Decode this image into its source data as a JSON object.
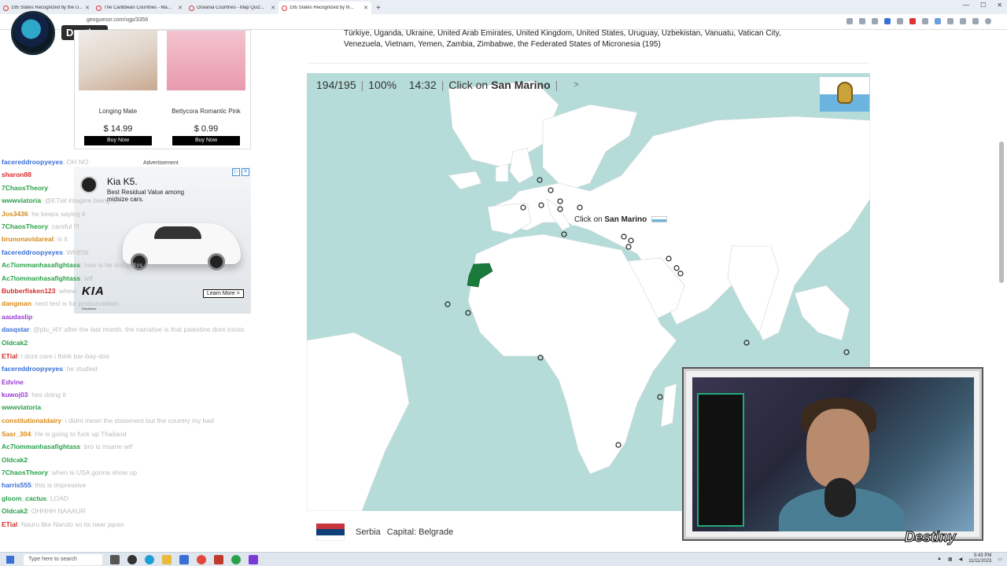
{
  "browser": {
    "tabs": [
      {
        "label": "195 States Recognized by the U...",
        "active": false
      },
      {
        "label": "The Caribbean Countries - Ma...",
        "active": false
      },
      {
        "label": "Oceania Countries - Map Quiz...",
        "active": false
      },
      {
        "label": "195 States Recognized by th...",
        "active": true
      }
    ],
    "url": "geoguessr.com/vgp/3356",
    "new_tab": "+"
  },
  "streamer": {
    "name": "Destiny"
  },
  "products": [
    {
      "name": "Longing Mate",
      "price": "$ 14.99",
      "buy": "Buy Now"
    },
    {
      "name": "Bettycora Romantic Pink",
      "price": "$ 0.99",
      "buy": "Buy Now"
    }
  ],
  "ad": {
    "label": "Advertisement",
    "title": "Kia K5.",
    "text": "Best Residual Value among midsize cars.",
    "brand": "KIA",
    "learn_more": "Learn More >",
    "disclaimer": "Disclaimer"
  },
  "chat": [
    {
      "user": "facereddroopyeyes",
      "color": "#3a6fd6",
      "msg": ": OH NO"
    },
    {
      "user": "sharon88",
      "color": "#d62b2b",
      "msg": ":"
    },
    {
      "user": "7ChaosTheory",
      "color": "#2aa04a",
      "msg": ":"
    },
    {
      "user": "wwwviatoria",
      "color": "#2aa04a",
      "msg": ": @ETial imagine being..."
    },
    {
      "user": "Jos3436",
      "color": "#d68a1a",
      "msg": ": he keeps saying it"
    },
    {
      "user": "7ChaosTheory",
      "color": "#2aa04a",
      "msg": ": careful !!!"
    },
    {
      "user": "brunonavidareal",
      "color": "#d68a1a",
      "msg": ": is it"
    },
    {
      "user": "facereddroopyeyes",
      "color": "#3a6fd6",
      "msg": ": WHEW"
    },
    {
      "user": "Ac7lommanhasafightass",
      "color": "#2aa04a",
      "msg": ": how is he doing this"
    },
    {
      "user": "Ac7lommanhasafightass",
      "color": "#2aa04a",
      "msg": ": wtf"
    },
    {
      "user": "Bubberfisken123",
      "color": "#d62b2b",
      "msg": ": whew"
    },
    {
      "user": "dangman",
      "color": "#d68a1a",
      "msg": ": next test is for pronunciation"
    },
    {
      "user": "aaudaslip",
      "color": "#9a3ad6",
      "msg": ":"
    },
    {
      "user": "dasqstar",
      "color": "#3a6fd6",
      "msg": ": @plu_l4Y after the last month, the narrative is that palestine dont exists",
      "wrap": true
    },
    {
      "user": "Oldcak2",
      "color": "#2aa04a",
      "msg": ":"
    },
    {
      "user": "ETial",
      "color": "#d62b2b",
      "msg": ": i dont care i think bar-bay-dos"
    },
    {
      "user": "facereddroopyeyes",
      "color": "#3a6fd6",
      "msg": ": he studied"
    },
    {
      "user": "Edvine",
      "color": "#9a3ad6",
      "msg": ":"
    },
    {
      "user": "kuwoj03",
      "color": "#9a3ad6",
      "msg": ": hes doing it"
    },
    {
      "user": "wwwviatoria",
      "color": "#2aa04a",
      "msg": ":"
    },
    {
      "user": "constitutionaldairy",
      "color": "#d68a1a",
      "msg": ": i didnt mean the statement but the country my bad",
      "wrap": true
    },
    {
      "user": "Sasr_304",
      "color": "#d68a1a",
      "msg": ": He is going to fuck up Thailand"
    },
    {
      "user": "Ac7lommanhasafightass",
      "color": "#2aa04a",
      "msg": ": bro is insane wtf"
    },
    {
      "user": "Oldcak2",
      "color": "#2aa04a",
      "msg": ":"
    },
    {
      "user": "7ChaosTheory",
      "color": "#2aa04a",
      "msg": ": when is USA gonna show up"
    },
    {
      "user": "harris555",
      "color": "#3a6fd6",
      "msg": ": this is impressive"
    },
    {
      "user": "gloom_cactus",
      "color": "#2aa04a",
      "msg": ": LOAD"
    },
    {
      "user": "Oldcak2",
      "color": "#2aa04a",
      "msg": ": OHHHH NAAAUR"
    },
    {
      "user": "ETial",
      "color": "#d62b2b",
      "msg": ": Nauru like Naruto so its near japan"
    }
  ],
  "page": {
    "state_list_text": "Türkiye, Uganda, Ukraine, United Arab Emirates, United Kingdom, United States, Uruguay, Uzbekistan, Vanuatu, Vatican City, Venezuela, Vietnam, Yemen, Zambia, Zimbabwe, the Federated States of Micronesia (195)"
  },
  "quiz": {
    "progress": "194/195",
    "accuracy": "100%",
    "timer": "14:32",
    "prompt_label": "Click on",
    "target": "San Marino",
    "next_icon": "chevron-right-icon"
  },
  "tooltip": {
    "label": "Click on",
    "target": "San Marino"
  },
  "footer": {
    "country": "Serbia",
    "capital": "Capital: Belgrade",
    "flag_colors": [
      "#c6363c",
      "#0c4076",
      "#ffffff"
    ]
  },
  "taskbar": {
    "search_placeholder": "Type here to search",
    "time": "5:43 PM",
    "date": "11/11/2023"
  },
  "colors": {
    "ocean": "#b6dcd9",
    "land": "#ffffff",
    "highlight": "#1a7a3c",
    "san_marino_blue": "#6cb4e0"
  }
}
